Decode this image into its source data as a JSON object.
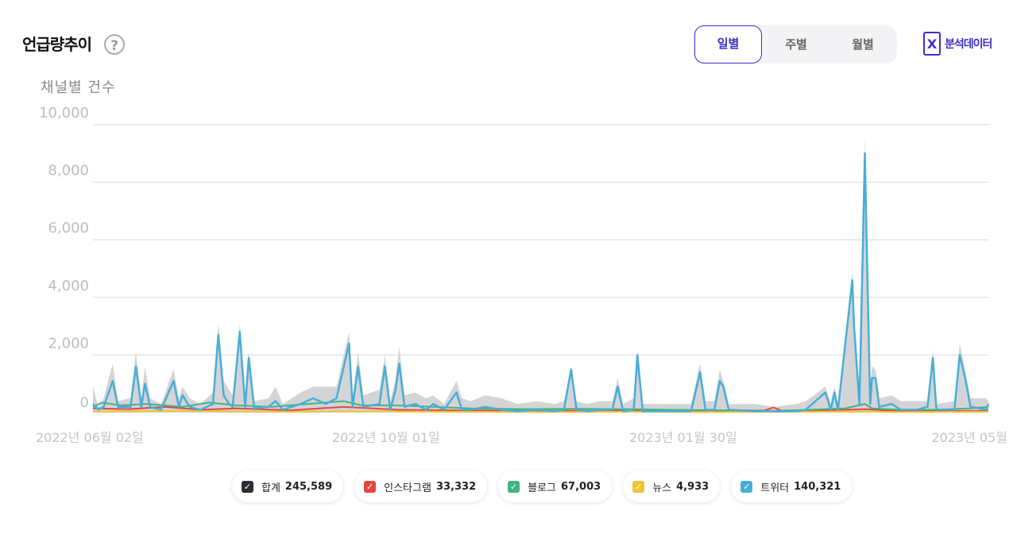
{
  "header": {
    "title": "언급량추이",
    "help_icon": "?",
    "period_tabs": [
      {
        "label": "일별",
        "active": true
      },
      {
        "label": "주별",
        "active": false
      },
      {
        "label": "월별",
        "active": false
      }
    ],
    "excel_label": "분석데이터",
    "excel_icon_text": "X"
  },
  "chart_data": {
    "type": "line",
    "ylabel": "채널별 건수",
    "ylim": [
      0,
      10000
    ],
    "yticks": [
      "10,000",
      "8,000",
      "6,000",
      "4,000",
      "2,000",
      "0"
    ],
    "xticks": [
      "2022년 06월 02일",
      "2022년 10월 01일",
      "2023년 01월 30일",
      "2023년 05월"
    ],
    "x_range": [
      "2022-06-02",
      "2023-05-31"
    ],
    "grid": true,
    "series": [
      {
        "name": "합계",
        "color": "#cfcfd3",
        "style": "area",
        "points": [
          [
            0,
            900
          ],
          [
            6,
            200
          ],
          [
            12,
            500
          ],
          [
            22,
            1700
          ],
          [
            28,
            400
          ],
          [
            42,
            500
          ],
          [
            48,
            2100
          ],
          [
            54,
            500
          ],
          [
            58,
            1600
          ],
          [
            64,
            500
          ],
          [
            76,
            300
          ],
          [
            90,
            1500
          ],
          [
            96,
            500
          ],
          [
            100,
            900
          ],
          [
            108,
            500
          ],
          [
            120,
            300
          ],
          [
            134,
            700
          ],
          [
            140,
            3100
          ],
          [
            146,
            1100
          ],
          [
            152,
            800
          ],
          [
            156,
            600
          ],
          [
            164,
            3100
          ],
          [
            170,
            500
          ],
          [
            174,
            2100
          ],
          [
            180,
            400
          ],
          [
            196,
            500
          ],
          [
            204,
            900
          ],
          [
            212,
            300
          ],
          [
            232,
            700
          ],
          [
            246,
            900
          ],
          [
            260,
            900
          ],
          [
            272,
            900
          ],
          [
            286,
            2800
          ],
          [
            290,
            500
          ],
          [
            296,
            2100
          ],
          [
            302,
            600
          ],
          [
            320,
            800
          ],
          [
            326,
            2000
          ],
          [
            332,
            400
          ],
          [
            338,
            1200
          ],
          [
            342,
            2300
          ],
          [
            348,
            600
          ],
          [
            360,
            700
          ],
          [
            372,
            500
          ],
          [
            380,
            600
          ],
          [
            392,
            300
          ],
          [
            406,
            1100
          ],
          [
            412,
            500
          ],
          [
            422,
            400
          ],
          [
            438,
            600
          ],
          [
            456,
            500
          ],
          [
            474,
            300
          ],
          [
            496,
            400
          ],
          [
            516,
            300
          ],
          [
            526,
            400
          ],
          [
            534,
            1600
          ],
          [
            540,
            400
          ],
          [
            552,
            300
          ],
          [
            566,
            400
          ],
          [
            580,
            400
          ],
          [
            586,
            1200
          ],
          [
            592,
            300
          ],
          [
            604,
            500
          ],
          [
            608,
            2100
          ],
          [
            614,
            300
          ],
          [
            640,
            300
          ],
          [
            668,
            300
          ],
          [
            678,
            1700
          ],
          [
            684,
            400
          ],
          [
            694,
            400
          ],
          [
            700,
            1500
          ],
          [
            704,
            1100
          ],
          [
            710,
            300
          ],
          [
            740,
            300
          ],
          [
            760,
            200
          ],
          [
            786,
            300
          ],
          [
            796,
            400
          ],
          [
            818,
            900
          ],
          [
            824,
            300
          ],
          [
            828,
            900
          ],
          [
            832,
            300
          ],
          [
            848,
            4900
          ],
          [
            850,
            3300
          ],
          [
            856,
            600
          ],
          [
            862,
            9600
          ],
          [
            864,
            6600
          ],
          [
            868,
            800
          ],
          [
            870,
            1600
          ],
          [
            874,
            1500
          ],
          [
            878,
            500
          ],
          [
            892,
            600
          ],
          [
            902,
            400
          ],
          [
            920,
            400
          ],
          [
            932,
            400
          ],
          [
            938,
            2200
          ],
          [
            942,
            300
          ],
          [
            962,
            400
          ],
          [
            968,
            2400
          ],
          [
            974,
            1500
          ],
          [
            980,
            500
          ],
          [
            998,
            500
          ],
          [
            1000,
            400
          ]
        ]
      },
      {
        "name": "인스타그램",
        "color": "#e5473f",
        "style": "line",
        "points": [
          [
            0,
            150
          ],
          [
            40,
            120
          ],
          [
            80,
            200
          ],
          [
            120,
            100
          ],
          [
            160,
            150
          ],
          [
            220,
            80
          ],
          [
            280,
            200
          ],
          [
            340,
            100
          ],
          [
            400,
            80
          ],
          [
            500,
            60
          ],
          [
            600,
            70
          ],
          [
            700,
            60
          ],
          [
            750,
            80
          ],
          [
            760,
            180
          ],
          [
            770,
            60
          ],
          [
            800,
            60
          ],
          [
            862,
            120
          ],
          [
            900,
            50
          ],
          [
            1000,
            60
          ]
        ]
      },
      {
        "name": "블로그",
        "color": "#3fb582",
        "style": "line",
        "points": [
          [
            0,
            200
          ],
          [
            10,
            350
          ],
          [
            30,
            250
          ],
          [
            60,
            300
          ],
          [
            100,
            200
          ],
          [
            130,
            350
          ],
          [
            160,
            250
          ],
          [
            200,
            200
          ],
          [
            240,
            300
          ],
          [
            280,
            400
          ],
          [
            300,
            250
          ],
          [
            340,
            250
          ],
          [
            380,
            200
          ],
          [
            420,
            150
          ],
          [
            480,
            120
          ],
          [
            540,
            130
          ],
          [
            600,
            120
          ],
          [
            640,
            100
          ],
          [
            700,
            80
          ],
          [
            760,
            60
          ],
          [
            800,
            100
          ],
          [
            840,
            150
          ],
          [
            862,
            300
          ],
          [
            870,
            150
          ],
          [
            900,
            100
          ],
          [
            940,
            100
          ],
          [
            980,
            150
          ],
          [
            1000,
            200
          ]
        ]
      },
      {
        "name": "뉴스",
        "color": "#f2c233",
        "style": "line",
        "points": [
          [
            0,
            30
          ],
          [
            100,
            60
          ],
          [
            200,
            30
          ],
          [
            300,
            50
          ],
          [
            400,
            30
          ],
          [
            500,
            20
          ],
          [
            600,
            30
          ],
          [
            700,
            20
          ],
          [
            800,
            30
          ],
          [
            862,
            40
          ],
          [
            900,
            20
          ],
          [
            1000,
            30
          ]
        ]
      },
      {
        "name": "트위터",
        "color": "#47aed8",
        "style": "line",
        "points": [
          [
            0,
            300
          ],
          [
            6,
            100
          ],
          [
            12,
            200
          ],
          [
            22,
            1100
          ],
          [
            28,
            200
          ],
          [
            42,
            200
          ],
          [
            48,
            1600
          ],
          [
            54,
            200
          ],
          [
            58,
            1000
          ],
          [
            64,
            200
          ],
          [
            76,
            100
          ],
          [
            90,
            1100
          ],
          [
            96,
            200
          ],
          [
            100,
            600
          ],
          [
            108,
            200
          ],
          [
            120,
            100
          ],
          [
            134,
            300
          ],
          [
            140,
            2700
          ],
          [
            146,
            600
          ],
          [
            152,
            300
          ],
          [
            156,
            200
          ],
          [
            164,
            2800
          ],
          [
            170,
            200
          ],
          [
            174,
            1900
          ],
          [
            180,
            150
          ],
          [
            196,
            200
          ],
          [
            204,
            400
          ],
          [
            212,
            100
          ],
          [
            232,
            300
          ],
          [
            246,
            500
          ],
          [
            260,
            300
          ],
          [
            272,
            500
          ],
          [
            286,
            2400
          ],
          [
            290,
            200
          ],
          [
            296,
            1600
          ],
          [
            302,
            200
          ],
          [
            320,
            300
          ],
          [
            326,
            1600
          ],
          [
            332,
            100
          ],
          [
            338,
            800
          ],
          [
            342,
            1700
          ],
          [
            348,
            200
          ],
          [
            360,
            300
          ],
          [
            372,
            100
          ],
          [
            380,
            300
          ],
          [
            392,
            100
          ],
          [
            406,
            700
          ],
          [
            412,
            100
          ],
          [
            422,
            100
          ],
          [
            438,
            200
          ],
          [
            456,
            100
          ],
          [
            474,
            50
          ],
          [
            496,
            100
          ],
          [
            516,
            50
          ],
          [
            526,
            100
          ],
          [
            534,
            1500
          ],
          [
            540,
            100
          ],
          [
            552,
            50
          ],
          [
            566,
            100
          ],
          [
            580,
            100
          ],
          [
            586,
            900
          ],
          [
            592,
            50
          ],
          [
            604,
            100
          ],
          [
            608,
            2000
          ],
          [
            614,
            50
          ],
          [
            640,
            50
          ],
          [
            668,
            50
          ],
          [
            678,
            1400
          ],
          [
            684,
            100
          ],
          [
            694,
            100
          ],
          [
            700,
            1100
          ],
          [
            704,
            900
          ],
          [
            710,
            100
          ],
          [
            740,
            50
          ],
          [
            760,
            50
          ],
          [
            786,
            50
          ],
          [
            796,
            100
          ],
          [
            818,
            700
          ],
          [
            824,
            100
          ],
          [
            828,
            700
          ],
          [
            832,
            100
          ],
          [
            848,
            4600
          ],
          [
            850,
            3000
          ],
          [
            856,
            300
          ],
          [
            862,
            9000
          ],
          [
            864,
            6000
          ],
          [
            868,
            300
          ],
          [
            870,
            1200
          ],
          [
            874,
            1200
          ],
          [
            878,
            200
          ],
          [
            892,
            300
          ],
          [
            902,
            100
          ],
          [
            920,
            100
          ],
          [
            932,
            200
          ],
          [
            938,
            1900
          ],
          [
            942,
            100
          ],
          [
            962,
            100
          ],
          [
            968,
            2000
          ],
          [
            974,
            1200
          ],
          [
            980,
            200
          ],
          [
            998,
            100
          ],
          [
            1000,
            300
          ]
        ]
      }
    ]
  },
  "legend": [
    {
      "name": "합계",
      "value": "245,589",
      "color": "#2b2e36"
    },
    {
      "name": "인스타그램",
      "value": "33,332",
      "color": "#e5473f"
    },
    {
      "name": "블로그",
      "value": "67,003",
      "color": "#3fb582"
    },
    {
      "name": "뉴스",
      "value": "4,933",
      "color": "#f2c233"
    },
    {
      "name": "트위터",
      "value": "140,321",
      "color": "#47aed8"
    }
  ]
}
